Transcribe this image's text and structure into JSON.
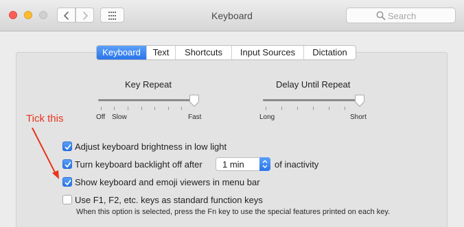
{
  "window": {
    "title": "Keyboard"
  },
  "toolbar": {
    "back_icon": "chevron-left-icon",
    "forward_icon": "chevron-right-icon",
    "grid_icon": "grid-icon",
    "search_placeholder": "Search"
  },
  "tabs": [
    {
      "label": "Keyboard",
      "selected": true
    },
    {
      "label": "Text",
      "selected": false
    },
    {
      "label": "Shortcuts",
      "selected": false
    },
    {
      "label": "Input Sources",
      "selected": false
    },
    {
      "label": "Dictation",
      "selected": false
    }
  ],
  "key_repeat": {
    "title": "Key Repeat",
    "labels": {
      "off": "Off",
      "slow": "Slow",
      "fast": "Fast"
    },
    "value_fraction": 1.0
  },
  "delay_until_repeat": {
    "title": "Delay Until Repeat",
    "labels": {
      "long": "Long",
      "short": "Short"
    },
    "value_fraction": 1.0
  },
  "options": [
    {
      "label": "Adjust keyboard brightness in low light",
      "checked": true
    },
    {
      "label": "Turn keyboard backlight off after",
      "checked": true,
      "suffix": "of inactivity"
    },
    {
      "label": "Show keyboard and emoji viewers in menu bar",
      "checked": true
    },
    {
      "label": "Use F1, F2, etc. keys as standard function keys",
      "checked": false,
      "note": "When this option is selected, press the Fn key to use the special features printed on each key."
    }
  ],
  "backlight_timeout": {
    "value": "1 min"
  },
  "annotation": {
    "text": "Tick this",
    "color": "#e8341c"
  },
  "colors": {
    "accent": "#2a74ea"
  }
}
